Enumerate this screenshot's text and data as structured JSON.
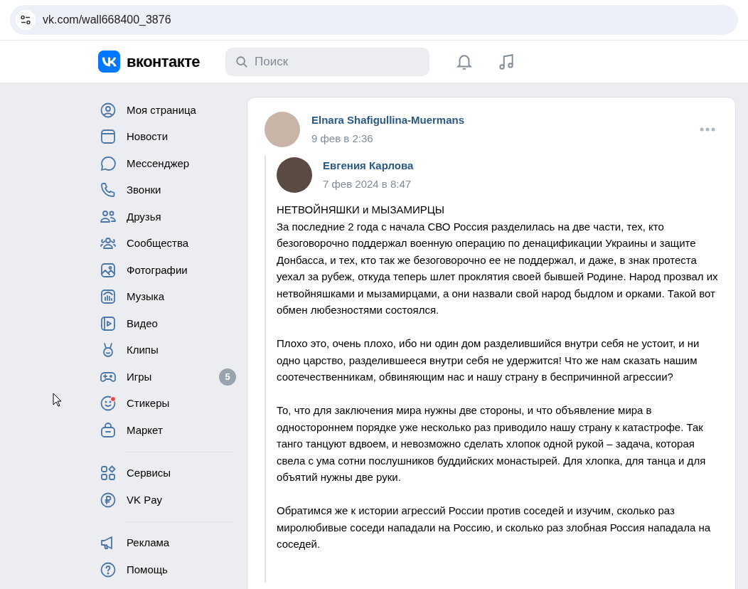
{
  "browser": {
    "url": "vk.com/wall668400_3876"
  },
  "header": {
    "logo": "вконтакте",
    "search": {
      "placeholder": "Поиск"
    }
  },
  "sidebar": {
    "groups": [
      [
        {
          "label": "Моя страница"
        },
        {
          "label": "Новости"
        },
        {
          "label": "Мессенджер"
        },
        {
          "label": "Звонки"
        },
        {
          "label": "Друзья"
        },
        {
          "label": "Сообщества"
        },
        {
          "label": "Фотографии"
        },
        {
          "label": "Музыка"
        },
        {
          "label": "Видео"
        },
        {
          "label": "Клипы"
        },
        {
          "label": "Игры",
          "badge": "5"
        },
        {
          "label": "Стикеры",
          "dot": true
        },
        {
          "label": "Маркет"
        }
      ],
      [
        {
          "label": "Сервисы"
        },
        {
          "label": "VK Pay"
        }
      ],
      [
        {
          "label": "Реклама"
        },
        {
          "label": "Помощь"
        }
      ]
    ]
  },
  "post": {
    "author": "Elnara Shafigullina-Muermans",
    "date": "9 фев в 2:36",
    "repost": {
      "author": "Евгения Карлова",
      "date": "7 фев 2024 в 8:47",
      "paragraphs": [
        "НЕТВОЙНЯШКИ и МЫЗАМИРЦЫ\nЗа последние 2 года с начала СВО Россия разделилась на две части, тех, кто безоговорочно поддержал военную операцию по денацификации Украины и защите Донбасса, и тех, кто так же безоговорочно ее не поддержал, и даже, в знак протеста уехал за рубеж, откуда теперь шлет проклятия своей бывшей Родине. Народ прозвал их нетвойняшками и мызамирцами, а они назвали свой народ быдлом и орками. Такой вот обмен любезностями состоялся.",
        "Плохо это, очень плохо, ибо ни один дом разделившийся внутри себя не устоит, и ни одно царство, разделившееся внутри себя не удержится! Что же нам сказать нашим соотечественникам, обвиняющим нас и нашу страну в беспричинной агрессии?",
        "То, что для заключения мира нужны две стороны, и что объявление мира в одностороннем порядке уже несколько раз приводило нашу страну к катастрофе. Так танго танцуют вдвоем, и невозможно сделать хлопок одной рукой – задача, которая свела с ума сотни послушников буддийских монастырей. Для хлопка, для танца и для объятий нужны две руки.",
        "Обратимся же к истории агрессий России против соседей и изучим, сколько раз миролюбивые соседи нападали на Россию, и сколько раз злобная Россия нападала на соседей."
      ]
    }
  }
}
